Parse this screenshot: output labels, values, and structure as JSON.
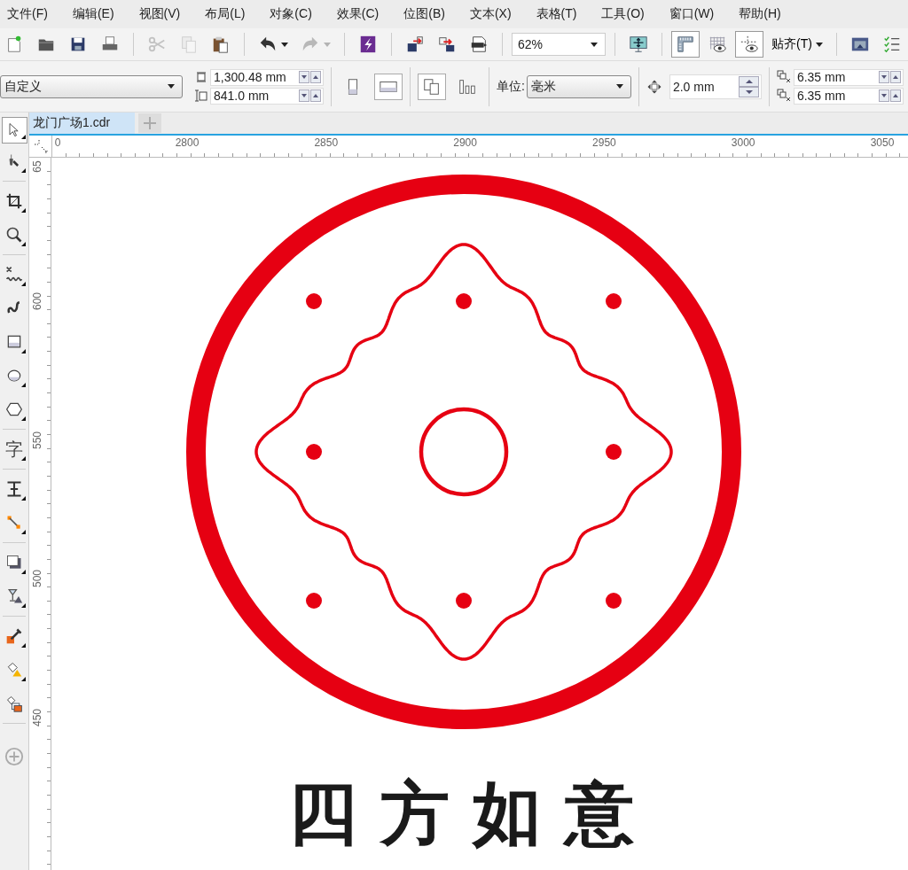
{
  "menu": [
    "文件(F)",
    "编辑(E)",
    "视图(V)",
    "布局(L)",
    "对象(C)",
    "效果(C)",
    "位图(B)",
    "文本(X)",
    "表格(T)",
    "工具(O)",
    "窗口(W)",
    "帮助(H)"
  ],
  "toolbar": {
    "buttons": [
      {
        "disabled": false,
        "pressed": false
      },
      {
        "disabled": false,
        "pressed": false
      },
      {
        "disabled": false,
        "pressed": false
      },
      {
        "disabled": false,
        "pressed": false
      },
      {
        "disabled": true,
        "pressed": false
      },
      {
        "disabled": true,
        "pressed": false
      },
      {
        "disabled": false,
        "pressed": false
      },
      {
        "disabled": false,
        "pressed": false
      },
      {
        "disabled": true,
        "pressed": false
      },
      {
        "disabled": false,
        "pressed": false
      },
      {
        "disabled": false,
        "pressed": false
      },
      {
        "disabled": false,
        "pressed": false
      },
      {
        "disabled": false,
        "pressed": false
      },
      {
        "disabled": false,
        "pressed": false
      },
      {
        "disabled": false,
        "pressed": true
      },
      {
        "disabled": false,
        "pressed": false
      },
      {
        "disabled": false,
        "pressed": true
      },
      {
        "disabled": false,
        "pressed": false
      },
      {
        "disabled": false,
        "pressed": false
      }
    ],
    "zoom": "62%",
    "snap": "贴齐(T)"
  },
  "property_bar": {
    "preset": "自定义",
    "width": "1,300.48 mm",
    "height": "841.0 mm",
    "orientation": [
      {
        "selected": false
      },
      {
        "selected": true
      }
    ],
    "page_layout": [
      {
        "selected": true
      },
      {
        "selected": false
      }
    ],
    "units_label": "单位:",
    "units": "毫米",
    "nudge": "2.0 mm",
    "duplicate_x": "6.35 mm",
    "duplicate_y": "6.35 mm"
  },
  "toolbox": {
    "tools": [
      {
        "selected": true
      },
      {
        "selected": false
      },
      {
        "selected": false
      },
      {
        "selected": false
      },
      {
        "selected": false
      },
      {
        "selected": false
      },
      {
        "selected": false
      },
      {
        "selected": false
      },
      {
        "selected": false
      },
      {
        "selected": false,
        "label": "字"
      },
      {
        "selected": false
      },
      {
        "selected": false
      },
      {
        "selected": false
      },
      {
        "selected": false
      },
      {
        "selected": false
      },
      {
        "selected": false
      },
      {
        "selected": false
      }
    ]
  },
  "tabs": [
    {
      "label": "龙门广场1.cdr",
      "selected": true
    }
  ],
  "ruler": {
    "horizontal": [
      "0",
      "2800",
      "2850",
      "2900",
      "2950",
      "3000",
      "3050"
    ],
    "vertical": [
      "65",
      "600",
      "550",
      "500",
      "450"
    ]
  },
  "artwork": {
    "title": "四方如意"
  }
}
